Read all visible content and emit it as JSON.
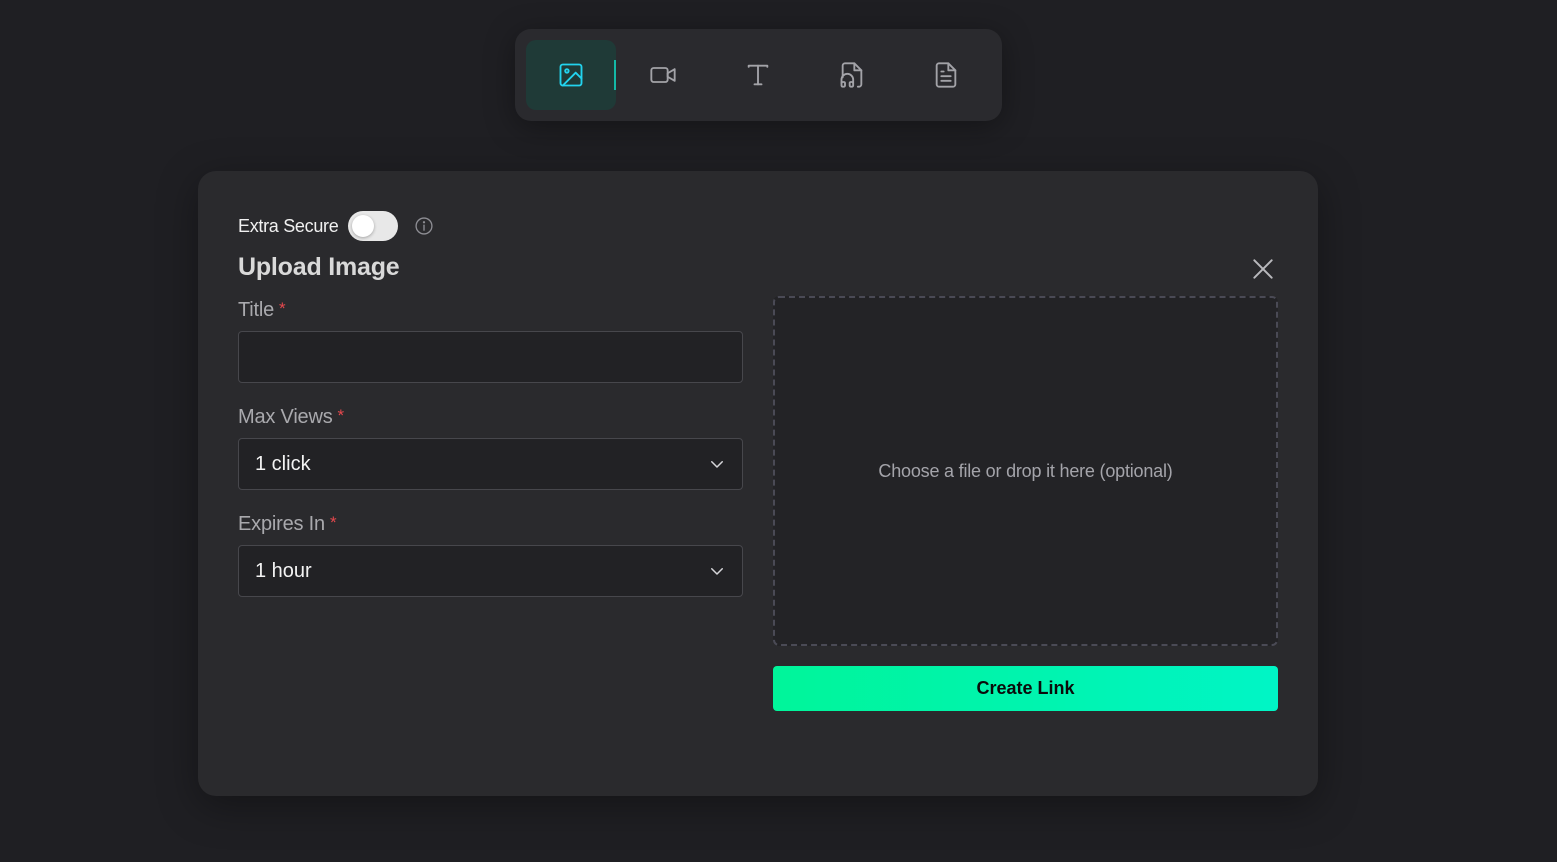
{
  "toolbar": {
    "tabs": [
      {
        "icon": "image-icon",
        "active": true
      },
      {
        "icon": "video-icon",
        "active": false
      },
      {
        "icon": "text-icon",
        "active": false
      },
      {
        "icon": "audio-file-icon",
        "active": false
      },
      {
        "icon": "document-icon",
        "active": false
      }
    ]
  },
  "form": {
    "extra_secure_label": "Extra Secure",
    "extra_secure_enabled": false,
    "heading": "Upload Image",
    "title_label": "Title",
    "title_value": "",
    "max_views_label": "Max Views",
    "max_views_value": "1 click",
    "expires_label": "Expires In",
    "expires_value": "1 hour",
    "required_mark": "*",
    "dropzone_text": "Choose a file or drop it here (optional)",
    "create_button": "Create Link"
  },
  "colors": {
    "background": "#1f1f23",
    "card": "#2a2a2d",
    "accent": "#14b8a6",
    "button_gradient_start": "#00f59a",
    "button_gradient_end": "#00f5c6",
    "required": "#e5484d"
  }
}
